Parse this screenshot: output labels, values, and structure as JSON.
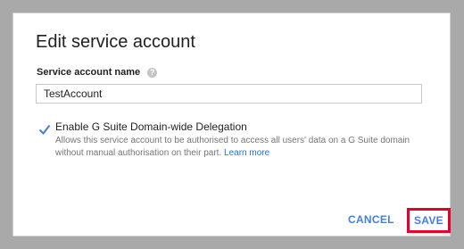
{
  "dialog": {
    "title": "Edit service account",
    "field": {
      "label": "Service account name",
      "help_icon": "help-circle-icon",
      "value": "TestAccount"
    },
    "delegation": {
      "checked": true,
      "label": "Enable G Suite Domain-wide Delegation",
      "description": "Allows this service account to be authorised to access all users' data on a G Suite domain without manual authorisation on their part.",
      "learn_more": "Learn more"
    },
    "actions": {
      "cancel_label": "CANCEL",
      "save_label": "SAVE"
    }
  },
  "colors": {
    "accent": "#3f7fe6",
    "highlight_border": "#e4002b",
    "backdrop": "#a9a9a9"
  }
}
